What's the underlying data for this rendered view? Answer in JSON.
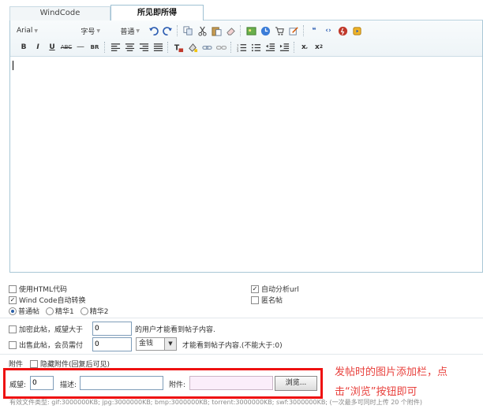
{
  "tabs": [
    {
      "label": "WindCode",
      "active": false
    },
    {
      "label": "所见即所得",
      "active": true
    }
  ],
  "toolbar": {
    "font_family": "Arial",
    "font_size": "字号",
    "font_style": "普通",
    "row1_icons": [
      "undo-icon",
      "redo-icon",
      "copy-icon",
      "cut-icon",
      "paste-icon",
      "eraser-icon",
      "image-icon",
      "history-icon",
      "cart-icon",
      "edit-icon",
      "quote-icon",
      "code-icon",
      "flash-icon",
      "media-icon"
    ],
    "row2_icons": [
      "bold-icon",
      "italic-icon",
      "underline-icon",
      "strikethrough-icon",
      "hr-icon",
      "br-icon",
      "align-left-icon",
      "align-center-icon",
      "align-right-icon",
      "justify-icon",
      "text-color-icon",
      "bg-color-icon",
      "link-icon",
      "unlink-icon",
      "ordered-list-icon",
      "unordered-list-icon",
      "outdent-icon",
      "indent-icon",
      "subscript-icon",
      "superscript-icon"
    ]
  },
  "options": {
    "use_html": "使用HTML代码",
    "auto_url": "自动分析url",
    "windcode_convert": "Wind Code自动转换",
    "anonymous": "匿名帖",
    "post_types": [
      "普通帖",
      "精华1",
      "精华2"
    ]
  },
  "restrict": {
    "prestige_label": "加密此帖，威望大于",
    "prestige_value": "0",
    "prestige_suffix": "的用户才能看到帖子内容.",
    "sell_label": "出售此帖，会员需付",
    "sell_value": "0",
    "currency": "金钱",
    "sell_suffix": "才能看到帖子内容.(不能大于:0)"
  },
  "attachment": {
    "label": "附件",
    "hide_label": "隐藏附件(回复后可见)",
    "prestige_label": "威望:",
    "prestige_value": "0",
    "desc_label": "描述:",
    "file_label": "附件:",
    "browse_button": "浏览..."
  },
  "annotation": {
    "line1": "发帖时的图片添加栏，点",
    "line2": "击“浏览”按钮即可"
  },
  "footer": "有效文件类型: gif:3000000KB; jpg:3000000KB; bmp:3000000KB; torrent:3000000KB; swf:3000000KB; (一次最多可同时上传 20 个附件)",
  "colors": {
    "highlight": "#ee1111",
    "annotation": "#e8403c",
    "border": "#a9c7d6"
  }
}
